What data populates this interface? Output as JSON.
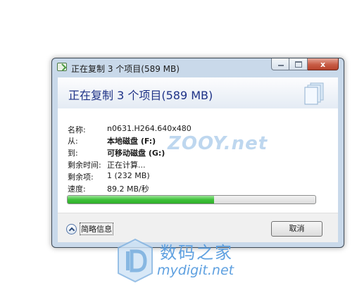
{
  "window": {
    "title": "正在复制 3 个项目(589 MB)",
    "close_glyph": "x"
  },
  "header": {
    "title": "正在复制 3 个项目(589 MB)"
  },
  "details": [
    {
      "label": "名称:",
      "value": "n0631.H264.640x480",
      "bold": false
    },
    {
      "label": "从:",
      "value": "本地磁盘 (F:)",
      "bold": true
    },
    {
      "label": "到:",
      "value": "可移动磁盘 (G:)",
      "bold": true
    },
    {
      "label": "剩余时间:",
      "value": "正在计算...",
      "bold": false
    },
    {
      "label": "剩余项:",
      "value": "1 (232 MB)",
      "bold": false
    },
    {
      "label": "速度:",
      "value": "89.2 MB/秒",
      "bold": false
    }
  ],
  "progress": {
    "fraction": 0.59
  },
  "footer": {
    "more_info_label": "简略信息",
    "cancel_label": "取消"
  },
  "watermarks": {
    "overlay_text": "ZOOY.net",
    "site_name_cn": "数码之家",
    "site_url": "mydigit.net"
  },
  "colors": {
    "header_title": "#1e3287",
    "progress_green": "#3fc23a",
    "close_red": "#c75c45",
    "watermark_blue": "#5ea0e0"
  },
  "icons": {
    "title": "copy-check-icon",
    "header": "document-stack-icon",
    "more": "chevron-up-icon",
    "logo": "mydigit-logo-icon"
  }
}
